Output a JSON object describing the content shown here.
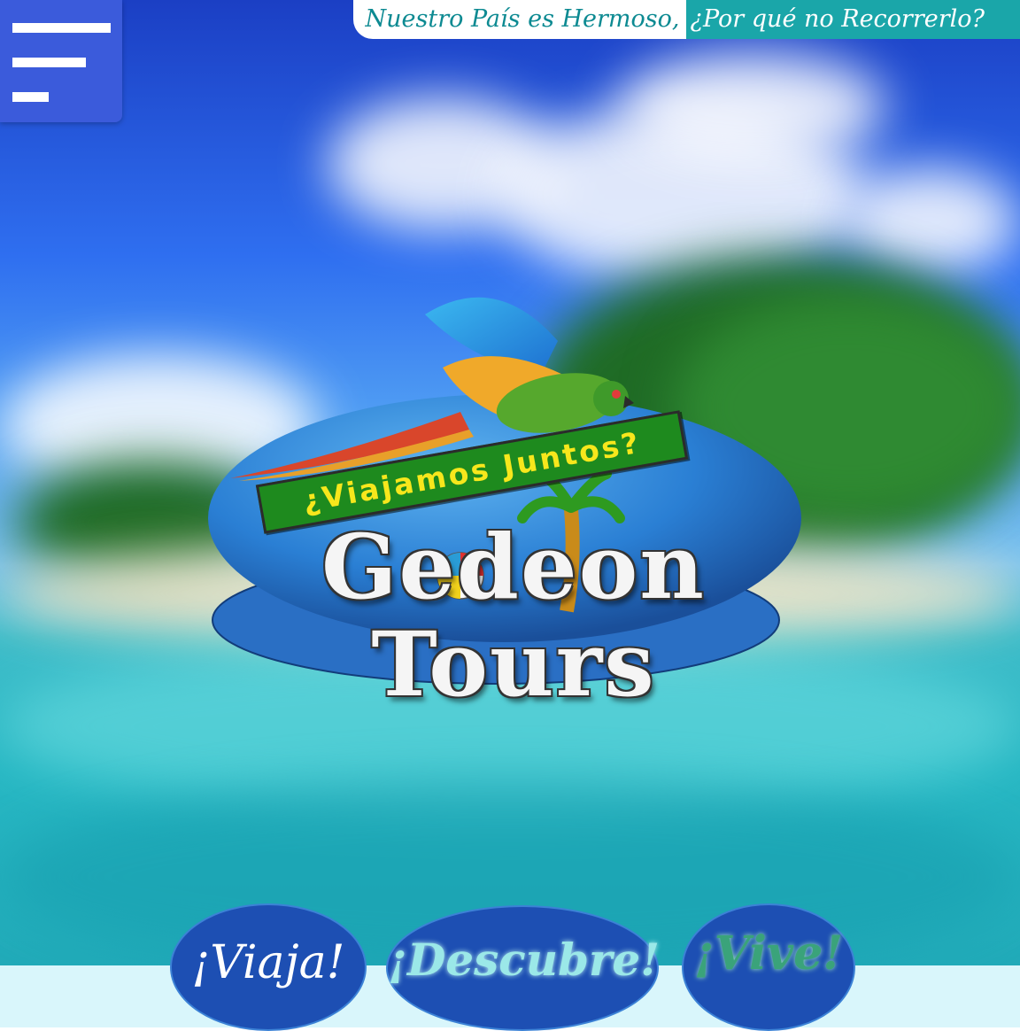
{
  "header": {
    "tagline_part1": "Nuestro País es Hermoso,",
    "tagline_part2": "¿Por qué no Recorrerlo?"
  },
  "menu": {
    "icon": "hamburger-menu-icon"
  },
  "logo": {
    "subtitle": "¿Viajamos Juntos?",
    "brand": "Gedeon Tours"
  },
  "actions": [
    {
      "label": "¡Viaja!"
    },
    {
      "label": "¡Descubre!"
    },
    {
      "label": "¡Vive!"
    }
  ],
  "colors": {
    "menu_bg": "#3b5bdb",
    "tagline_teal": "#1aa6a9",
    "pill_blue": "#1d4fb3",
    "footer_band": "#d9f6fb"
  }
}
